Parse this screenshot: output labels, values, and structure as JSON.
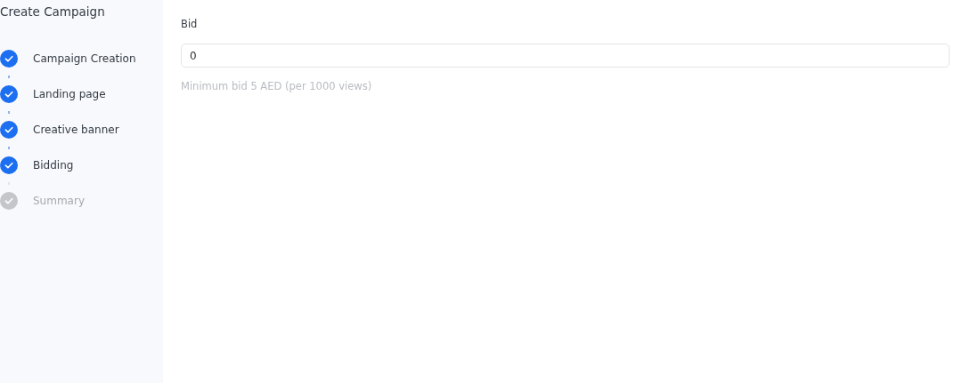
{
  "sidebar": {
    "title": "Create Campaign",
    "steps": [
      {
        "label": "Campaign Creation",
        "done": true
      },
      {
        "label": "Landing page",
        "done": true
      },
      {
        "label": "Creative banner",
        "done": true
      },
      {
        "label": "Bidding",
        "done": true
      },
      {
        "label": "Summary",
        "done": false
      }
    ]
  },
  "form": {
    "label": "Bid",
    "value": "0",
    "hint": "Minimum bid 5 AED (per 1000 views)"
  }
}
